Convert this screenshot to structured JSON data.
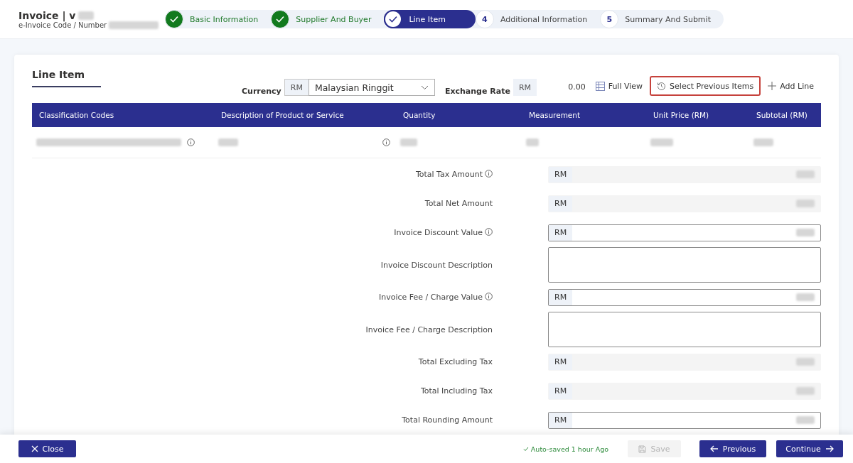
{
  "header": {
    "title": "Invoice | v",
    "subtitle": "e-Invoice Code / Number"
  },
  "steps": [
    {
      "label": "Basic Information",
      "completed": true,
      "selected": false
    },
    {
      "label": "Supplier And Buyer",
      "completed": true,
      "selected": false
    },
    {
      "label": "Line Item",
      "completed": true,
      "selected": true
    },
    {
      "label": "Additional Information",
      "number": "4",
      "completed": false,
      "selected": false
    },
    {
      "label": "Summary And Submit",
      "number": "5",
      "completed": false,
      "selected": false
    }
  ],
  "section_title": "Line Item",
  "toolbar": {
    "currency_label": "Currency",
    "currency_prefix": "RM",
    "currency_value": "Malaysian Ringgit",
    "exchange_label": "Exchange Rate",
    "exchange_prefix": "RM",
    "rate": "0.00",
    "full_view": "Full View",
    "select_previous": "Select Previous Items",
    "select_previous_highlighted": true,
    "add_line": "Add Line"
  },
  "table": {
    "columns": [
      "Classification Codes",
      "Description of Product or Service",
      "Quantity",
      "Measurement",
      "Unit Price (RM)",
      "Subtotal (RM)"
    ]
  },
  "summary": [
    {
      "label": "Total Tax Amount",
      "info": true,
      "kind": "readonly",
      "prefix": "RM"
    },
    {
      "label": "Total Net Amount",
      "info": false,
      "kind": "readonly",
      "prefix": "RM"
    },
    {
      "label": "Invoice Discount Value",
      "info": true,
      "kind": "input",
      "prefix": "RM"
    },
    {
      "label": "Invoice Discount Description",
      "info": false,
      "kind": "textarea"
    },
    {
      "label": "Invoice Fee / Charge Value",
      "info": true,
      "kind": "input",
      "prefix": "RM"
    },
    {
      "label": "Invoice Fee / Charge Description",
      "info": false,
      "kind": "textarea"
    },
    {
      "label": "Total Excluding Tax",
      "info": false,
      "kind": "readonly",
      "prefix": "RM"
    },
    {
      "label": "Total Including Tax",
      "info": false,
      "kind": "readonly",
      "prefix": "RM"
    },
    {
      "label": "Total Rounding Amount",
      "info": false,
      "kind": "input",
      "prefix": "RM"
    }
  ],
  "footer": {
    "close": "Close",
    "autosave": "Auto-saved 1 hour Ago",
    "save": "Save",
    "save_disabled": true,
    "previous": "Previous",
    "continue": "Continue"
  }
}
